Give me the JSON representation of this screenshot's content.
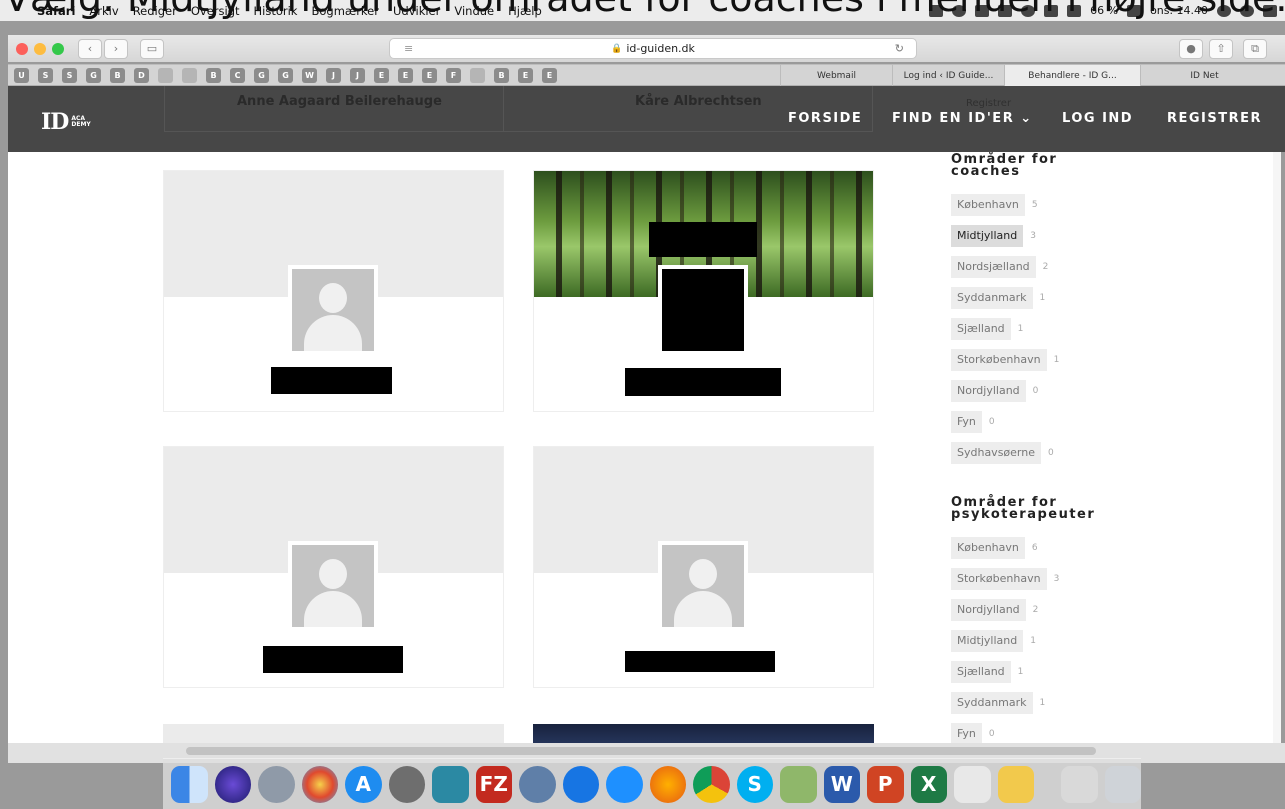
{
  "caption": "Vælg: Midtjylland under området for coaches i menuen i højre side.",
  "menubar": {
    "items": [
      "Safari",
      "Arkiv",
      "Rediger",
      "Oversigt",
      "Historik",
      "Bogmærker",
      "Udvikler",
      "Vindue",
      "Hjælp"
    ],
    "battery": "66 %",
    "clock": "ons. 14.40"
  },
  "browser": {
    "url": "id-guiden.dk",
    "favorites": [
      "U",
      "S",
      "S",
      "G",
      "B",
      "D",
      "",
      "",
      "B",
      "C",
      "G",
      "G",
      "W",
      "J",
      "J",
      "E",
      "E",
      "E",
      "F",
      "",
      "B",
      "E",
      "E"
    ],
    "tabs": [
      "Webmail",
      "Log ind ‹ ID Guide...",
      "Behandlere - ID G...",
      "ID Net"
    ],
    "active_tab_index": 2
  },
  "site": {
    "logo": "ID",
    "logo_sub_1": "ACA",
    "logo_sub_2": "DEMY",
    "ghost_names": [
      "Anne Aagaard Beilerehauge",
      "Kåre Albrechtsen"
    ],
    "ghost_register": "Registrer",
    "nav": {
      "home": "FORSIDE",
      "find": "FIND EN ID'ER",
      "login": "LOG IND",
      "register": "REGISTRER"
    }
  },
  "sidebar": {
    "coaches_title_1": "Områder for",
    "coaches_title_2": "coaches",
    "coaches": [
      {
        "label": "København",
        "count": "5",
        "selected": false
      },
      {
        "label": "Midtjylland",
        "count": "3",
        "selected": true
      },
      {
        "label": "Nordsjælland",
        "count": "2",
        "selected": false
      },
      {
        "label": "Syddanmark",
        "count": "1",
        "selected": false
      },
      {
        "label": "Sjælland",
        "count": "1",
        "selected": false
      },
      {
        "label": "Storkøbenhavn",
        "count": "1",
        "selected": false
      },
      {
        "label": "Nordjylland",
        "count": "0",
        "selected": false
      },
      {
        "label": "Fyn",
        "count": "0",
        "selected": false
      },
      {
        "label": "Sydhavsøerne",
        "count": "0",
        "selected": false
      }
    ],
    "psych_title_1": "Områder for",
    "psych_title_2": "psykoterapeuter",
    "psych": [
      {
        "label": "København",
        "count": "6"
      },
      {
        "label": "Storkøbenhavn",
        "count": "3"
      },
      {
        "label": "Nordjylland",
        "count": "2"
      },
      {
        "label": "Midtjylland",
        "count": "1"
      },
      {
        "label": "Sjælland",
        "count": "1"
      },
      {
        "label": "Syddanmark",
        "count": "1"
      },
      {
        "label": "Fyn",
        "count": "0"
      }
    ]
  },
  "colors": {
    "header_bg": "#474747",
    "selected_tag": "#dcdcdc",
    "tag_bg": "#ededed"
  }
}
